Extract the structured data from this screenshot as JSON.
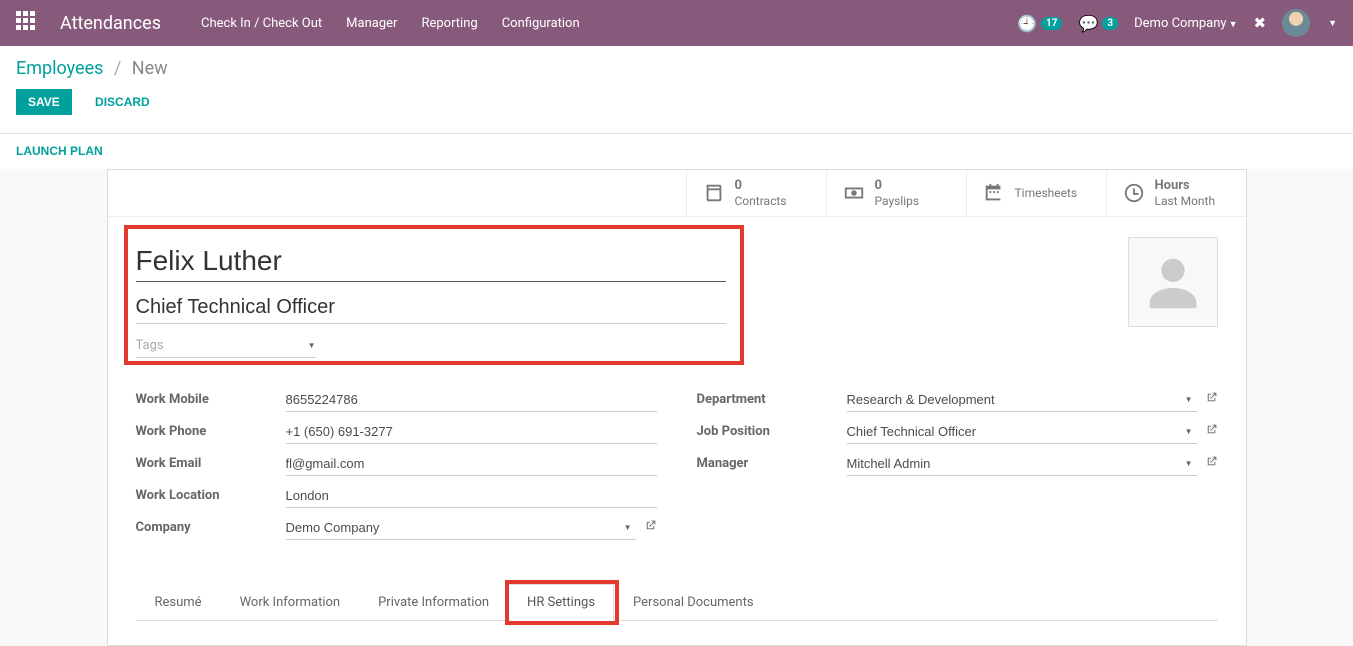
{
  "topbar": {
    "app_title": "Attendances",
    "menu": [
      "Check In / Check Out",
      "Manager",
      "Reporting",
      "Configuration"
    ],
    "clock_badge": "17",
    "chat_badge": "3",
    "company": "Demo Company"
  },
  "breadcrumb": {
    "root": "Employees",
    "current": "New"
  },
  "actions": {
    "save": "SAVE",
    "discard": "DISCARD",
    "launch": "LAUNCH PLAN"
  },
  "stat_buttons": [
    {
      "value": "0",
      "label": "Contracts",
      "icon": "book"
    },
    {
      "value": "0",
      "label": "Payslips",
      "icon": "money"
    },
    {
      "value": "",
      "label": "Timesheets",
      "icon": "calendar"
    },
    {
      "value": "Hours",
      "label": "Last Month",
      "icon": "clock"
    }
  ],
  "employee": {
    "name": "Felix Luther",
    "job_title": "Chief Technical Officer",
    "tags_placeholder": "Tags"
  },
  "left_fields": [
    {
      "label": "Work Mobile",
      "value": "8655224786",
      "type": "text"
    },
    {
      "label": "Work Phone",
      "value": "+1 (650) 691-3277",
      "type": "text"
    },
    {
      "label": "Work Email",
      "value": "fl@gmail.com",
      "type": "text"
    },
    {
      "label": "Work Location",
      "value": "London",
      "type": "text"
    },
    {
      "label": "Company",
      "value": "Demo Company",
      "type": "m2o"
    }
  ],
  "right_fields": [
    {
      "label": "Department",
      "value": "Research & Development",
      "type": "m2o"
    },
    {
      "label": "Job Position",
      "value": "Chief Technical Officer",
      "type": "m2o"
    },
    {
      "label": "Manager",
      "value": "Mitchell Admin",
      "type": "m2o"
    }
  ],
  "tabs": [
    "Resumé",
    "Work Information",
    "Private Information",
    "HR Settings",
    "Personal Documents"
  ],
  "active_tab": "HR Settings"
}
